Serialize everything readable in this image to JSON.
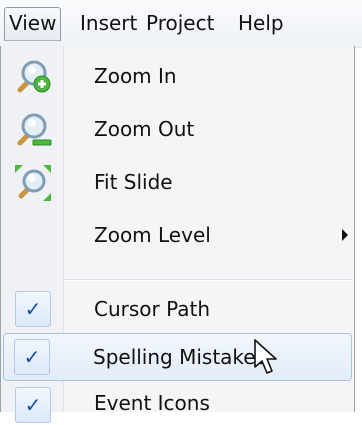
{
  "menubar": {
    "items": [
      {
        "label": "View",
        "active": true
      },
      {
        "label": "Insert"
      },
      {
        "label": "Project"
      },
      {
        "label": "Help"
      }
    ]
  },
  "view_menu": {
    "items": [
      {
        "label": "Zoom In",
        "icon": "zoom-in-icon"
      },
      {
        "label": "Zoom Out",
        "icon": "zoom-out-icon"
      },
      {
        "label": "Fit Slide",
        "icon": "fit-slide-icon"
      },
      {
        "label": "Zoom Level",
        "submenu": true
      },
      {
        "label": "Cursor Path",
        "checked": true
      },
      {
        "label": "Spelling Mistakes",
        "checked": true,
        "hovered": true
      },
      {
        "label": "Event Icons",
        "checked": true
      }
    ],
    "check_glyph": "✓"
  },
  "colors": {
    "hover_border": "#a9c1e3",
    "check_color": "#1c4fa8",
    "icon_green": "#4db83f",
    "icon_magnifier": "#8fb0c7"
  }
}
